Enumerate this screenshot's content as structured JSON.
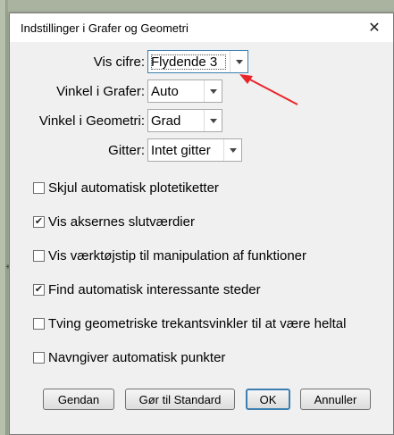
{
  "dialog": {
    "title": "Indstillinger i Grafer og Geometri",
    "close_glyph": "✕"
  },
  "fields": [
    {
      "label": "Vis cifre:",
      "value": "Flydende 3",
      "focused": true
    },
    {
      "label": "Vinkel i Grafer:",
      "value": "Auto",
      "focused": false
    },
    {
      "label": "Vinkel i Geometri:",
      "value": "Grad",
      "focused": false
    },
    {
      "label": "Gitter:",
      "value": "Intet gitter",
      "focused": false
    }
  ],
  "checkboxes": [
    {
      "label": "Skjul automatisk plotetiketter",
      "checked": false
    },
    {
      "label": "Vis aksernes slutværdier",
      "checked": true
    },
    {
      "label": "Vis værktøjstip til manipulation af funktioner",
      "checked": false
    },
    {
      "label": "Find automatisk interessante steder",
      "checked": true
    },
    {
      "label": "Tving geometriske trekantsvinkler til at være heltal",
      "checked": false
    },
    {
      "label": "Navngiver automatisk punkter",
      "checked": false
    }
  ],
  "buttons": {
    "restore": "Gendan",
    "make_default": "Gør til Standard",
    "ok": "OK",
    "cancel": "Annuller"
  },
  "colors": {
    "annotation_arrow": "#e8262a",
    "focus_border": "#3c7fb1"
  }
}
